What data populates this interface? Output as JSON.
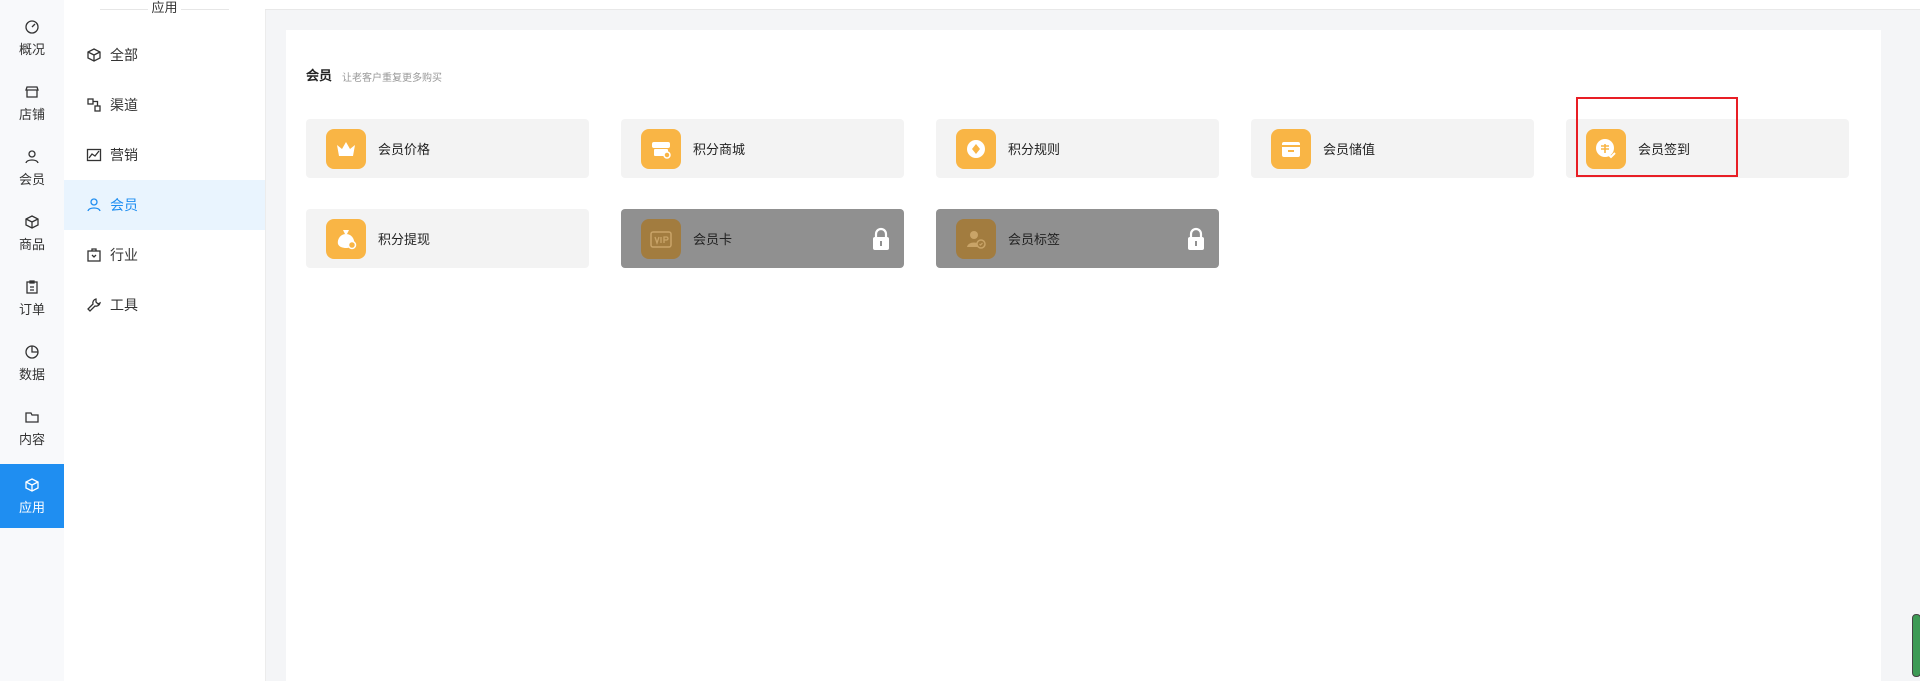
{
  "rail": {
    "items": [
      {
        "label": "概况",
        "icon": "dashboard-icon"
      },
      {
        "label": "店铺",
        "icon": "store-icon"
      },
      {
        "label": "会员",
        "icon": "user-icon"
      },
      {
        "label": "商品",
        "icon": "box-icon"
      },
      {
        "label": "订单",
        "icon": "clipboard-icon"
      },
      {
        "label": "数据",
        "icon": "pie-icon"
      },
      {
        "label": "内容",
        "icon": "folder-icon"
      },
      {
        "label": "应用",
        "icon": "cube-icon",
        "active": true
      }
    ]
  },
  "submenu": {
    "title": "应用",
    "items": [
      {
        "label": "全部",
        "icon": "cube-icon"
      },
      {
        "label": "渠道",
        "icon": "channel-icon"
      },
      {
        "label": "营销",
        "icon": "trend-icon"
      },
      {
        "label": "会员",
        "icon": "user-icon",
        "active": true
      },
      {
        "label": "行业",
        "icon": "briefcase-icon"
      },
      {
        "label": "工具",
        "icon": "wrench-icon"
      }
    ]
  },
  "section": {
    "title": "会员",
    "subtitle": "让老客户重复更多购买"
  },
  "cards": [
    {
      "label": "会员价格",
      "icon": "crown-icon",
      "locked": false
    },
    {
      "label": "积分商城",
      "icon": "shop-icon",
      "locked": false
    },
    {
      "label": "积分规则",
      "icon": "coin-icon",
      "locked": false
    },
    {
      "label": "会员储值",
      "icon": "wallet-icon",
      "locked": false
    },
    {
      "label": "会员签到",
      "icon": "checkin-icon",
      "locked": false
    },
    {
      "label": "积分提现",
      "icon": "money-bag-icon",
      "locked": false
    },
    {
      "label": "会员卡",
      "icon": "vip-card-icon",
      "locked": true
    },
    {
      "label": "会员标签",
      "icon": "user-tag-icon",
      "locked": true
    }
  ],
  "colors": {
    "accent": "#1f8ef1",
    "icon_bg": "#f9b545",
    "locked_bg": "#909090",
    "highlight": "#e81e25"
  }
}
